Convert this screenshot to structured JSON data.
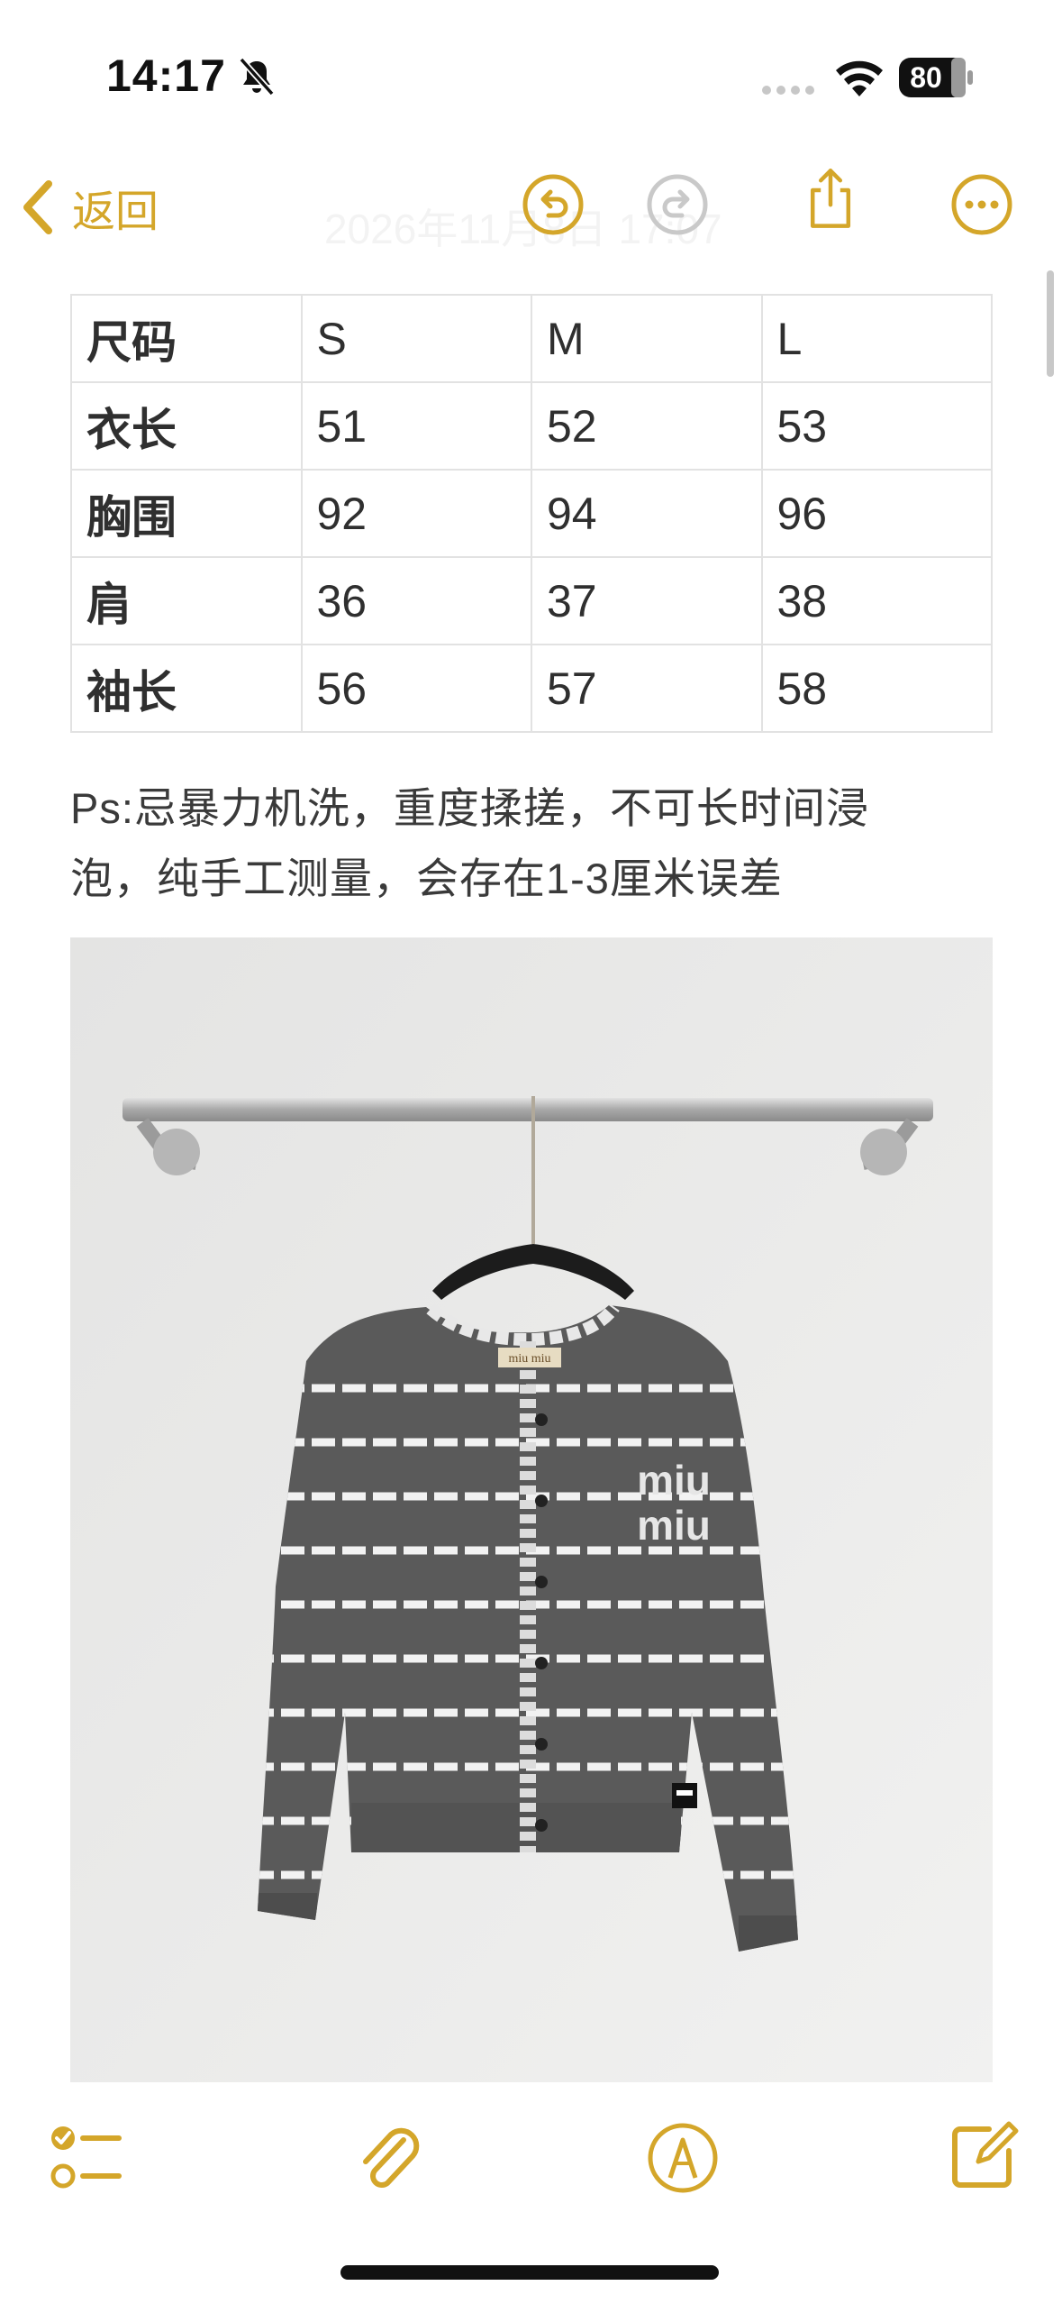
{
  "status_bar": {
    "time": "14:17",
    "battery": "80",
    "icons": [
      "bell-slash-icon",
      "signal-dots-icon",
      "wifi-icon",
      "battery-icon"
    ]
  },
  "nav": {
    "back_label": "返回",
    "date_text": "2026年11月8日 17:07",
    "icons": [
      "chevron-left-icon",
      "undo-icon",
      "redo-icon",
      "share-icon",
      "more-icon"
    ]
  },
  "size_table": {
    "header": [
      "尺码",
      "S",
      "M",
      "L"
    ],
    "rows": [
      [
        "衣长",
        "51",
        "52",
        "53"
      ],
      [
        "胸围",
        "92",
        "94",
        "96"
      ],
      [
        "肩",
        "36",
        "37",
        "38"
      ],
      [
        "袖长",
        "56",
        "57",
        "58"
      ]
    ]
  },
  "note": {
    "line1": "Ps:忌暴力机洗，重度揉搓，不可长时间浸",
    "line2": "泡，纯手工测量，会存在1-3厘米误差"
  },
  "photo": {
    "label_text": "miu miu",
    "logo_line1": "miu",
    "logo_line2": "miu"
  },
  "toolbar": {
    "icons": [
      "checklist-icon",
      "paperclip-icon",
      "markup-icon",
      "compose-icon"
    ]
  },
  "colors": {
    "accent": "#d4a62a",
    "sweater": "#5b5b5b",
    "wall": "#ececeb"
  }
}
